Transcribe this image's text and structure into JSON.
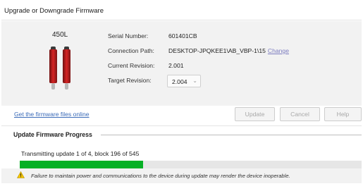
{
  "window": {
    "title": "Upgrade or Downgrade Firmware"
  },
  "device": {
    "model": "450L",
    "image": "safety-light-curtain-device"
  },
  "info": {
    "serial_label": "Serial Number:",
    "serial_value": "601401CB",
    "path_label": "Connection Path:",
    "path_value": "DESKTOP-JPQKEE1\\AB_VBP-1\\15",
    "change_label": "Change",
    "current_label": "Current Revision:",
    "current_value": "2.001",
    "target_label": "Target Revision:",
    "target_value": "2.004"
  },
  "firmware_link": "Get the firmware files online",
  "buttons": {
    "update": "Update",
    "cancel": "Cancel",
    "help": "Help"
  },
  "progress_section": {
    "title": "Update Firmware Progress",
    "status": "Transmitting update 1 of 4, block 196 of 545",
    "fill_percent": 36,
    "warning": "Failure to maintain power and communications to the device during update may render the device inoperable."
  },
  "colors": {
    "progress": "#06b025",
    "link": "#3b6bb8",
    "device_red": "#d72424"
  },
  "icons": {
    "warning": "warning-icon",
    "dropdown": "chevron-down-icon"
  }
}
